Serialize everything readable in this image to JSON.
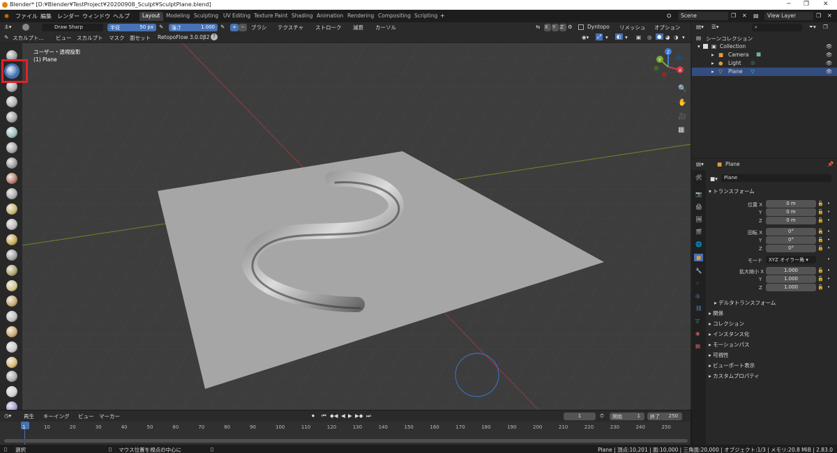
{
  "window": {
    "title": "Blender* [D:¥Blender¥TestProject¥20200908_Sculpt¥SculptPlane.blend]"
  },
  "menu": [
    "ファイル",
    "編集",
    "レンダー",
    "ウィンドウ",
    "ヘルプ"
  ],
  "workspaces": [
    "Layout",
    "Modeling",
    "Sculpting",
    "UV Editing",
    "Texture Paint",
    "Shading",
    "Animation",
    "Rendering",
    "Compositing",
    "Scripting"
  ],
  "scene": "Scene",
  "view_layer": "View Layer",
  "tool_header": {
    "brush": "Draw Sharp",
    "radius_label": "半径",
    "radius_value": "50 px",
    "strength_label": "強さ",
    "strength_value": "1.000",
    "brush_menu": "ブラシ",
    "texture_menu": "テクスチャ",
    "stroke_menu": "ストローク",
    "falloff_menu": "減衰",
    "cursor_menu": "カーソル",
    "axes": [
      "X",
      "Y",
      "Z"
    ],
    "dyntopo": "Dyntopo",
    "remesh": "リメッシュ",
    "options": "オプション"
  },
  "mode_header": {
    "mode": "スカルプト...",
    "items": [
      "ビュー",
      "スカルプト",
      "マスク",
      "面セット"
    ],
    "addon": "RetopoFlow 3.0.0β2"
  },
  "viewport": {
    "view_name": "ユーザー・透視投影",
    "object_info": "(1) Plane",
    "gizmo_axes": [
      "X",
      "Y",
      "Z"
    ]
  },
  "outliner": {
    "root": "シーンコレクション",
    "collection": "Collection",
    "items": [
      "Camera",
      "Light",
      "Plane"
    ]
  },
  "properties": {
    "object_name": "Plane",
    "object_field": "Plane",
    "transform_title": "トランスフォーム",
    "location_label": "位置 X",
    "rotation_label": "回転 X",
    "scale_label": "拡大縮小 X",
    "y_label": "Y",
    "z_label": "Z",
    "location": [
      "0 m",
      "0 m",
      "0 m"
    ],
    "rotation": [
      "0°",
      "0°",
      "0°"
    ],
    "mode_label": "モード",
    "mode_value": "XYZ オイラー角",
    "scale": [
      "1.000",
      "1.000",
      "1.000"
    ],
    "delta_transform": "デルタトランスフォーム",
    "sections": [
      "関係",
      "コレクション",
      "インスタンス化",
      "モーションパス",
      "可視性",
      "ビューポート表示",
      "カスタムプロパティ"
    ]
  },
  "timeline": {
    "menus": [
      "再生",
      "キーイング",
      "ビュー",
      "マーカー"
    ],
    "current_frame": "1",
    "start_label": "開始",
    "start": "1",
    "end_label": "終了",
    "end": "250",
    "ticks": [
      "1",
      "10",
      "20",
      "30",
      "40",
      "50",
      "60",
      "70",
      "80",
      "90",
      "100",
      "110",
      "120",
      "130",
      "140",
      "150",
      "160",
      "170",
      "180",
      "190",
      "200",
      "210",
      "220",
      "230",
      "240",
      "250"
    ]
  },
  "statusbar": {
    "left": "選択",
    "middle": "マウス位置を視点の中心に",
    "right": "Plane | 頂点:10,201 | 面:10,000 | 三角面:20,000 | オブジェクト:1/3 | メモリ:20.8 MiB | 2.83.0"
  },
  "colors": {
    "accent": "#4772b3",
    "highlight_box": "#e0232b",
    "selected_row": "#334d80"
  }
}
